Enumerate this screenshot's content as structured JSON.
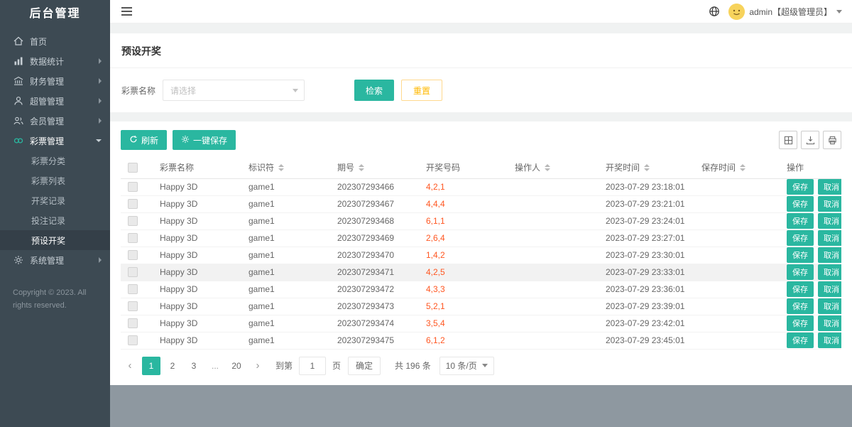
{
  "colors": {
    "accent_teal": "#2ab7a0",
    "warning_orange": "#ffb800",
    "number_red": "#ff5722",
    "sidebar_bg": "#3d4a53"
  },
  "sidebar": {
    "title": "后台管理",
    "items": [
      {
        "label": "首页",
        "icon": "home-icon",
        "arrow": "none"
      },
      {
        "label": "数据统计",
        "icon": "chart-icon",
        "arrow": "right"
      },
      {
        "label": "财务管理",
        "icon": "finance-icon",
        "arrow": "right"
      },
      {
        "label": "超管管理",
        "icon": "admin-user-icon",
        "arrow": "right"
      },
      {
        "label": "会员管理",
        "icon": "members-icon",
        "arrow": "right"
      },
      {
        "label": "彩票管理",
        "icon": "lottery-icon",
        "arrow": "down",
        "children": [
          "彩票分类",
          "彩票列表",
          "开奖记录",
          "投注记录",
          "预设开奖"
        ],
        "active_child": "预设开奖"
      },
      {
        "label": "系统管理",
        "icon": "gear-icon",
        "arrow": "right"
      }
    ],
    "copyright": "Copyright © 2023. All rights reserved."
  },
  "topbar": {
    "username": "admin【超级管理员】"
  },
  "page": {
    "title": "预设开奖",
    "search": {
      "label": "彩票名称",
      "select_placeholder": "请选择",
      "search_button": "检索",
      "reset_button": "重置"
    },
    "toolbar": {
      "refresh_button": "刷新",
      "save_all_button": "一键保存"
    },
    "table": {
      "action_save": "保存",
      "action_cancel": "取消",
      "headers": [
        {
          "label": "彩票名称",
          "sortable": false
        },
        {
          "label": "标识符",
          "sortable": true
        },
        {
          "label": "期号",
          "sortable": true
        },
        {
          "label": "开奖号码",
          "sortable": false
        },
        {
          "label": "操作人",
          "sortable": true
        },
        {
          "label": "开奖时间",
          "sortable": true
        },
        {
          "label": "保存时间",
          "sortable": true
        },
        {
          "label": "操作",
          "sortable": false
        }
      ],
      "rows": [
        {
          "name": "Happy 3D",
          "code": "game1",
          "issue": "202307293466",
          "numbers": "4,2,1",
          "operator": "",
          "draw_time": "2023-07-29 23:18:01",
          "save_time": ""
        },
        {
          "name": "Happy 3D",
          "code": "game1",
          "issue": "202307293467",
          "numbers": "4,4,4",
          "operator": "",
          "draw_time": "2023-07-29 23:21:01",
          "save_time": ""
        },
        {
          "name": "Happy 3D",
          "code": "game1",
          "issue": "202307293468",
          "numbers": "6,1,1",
          "operator": "",
          "draw_time": "2023-07-29 23:24:01",
          "save_time": ""
        },
        {
          "name": "Happy 3D",
          "code": "game1",
          "issue": "202307293469",
          "numbers": "2,6,4",
          "operator": "",
          "draw_time": "2023-07-29 23:27:01",
          "save_time": ""
        },
        {
          "name": "Happy 3D",
          "code": "game1",
          "issue": "202307293470",
          "numbers": "1,4,2",
          "operator": "",
          "draw_time": "2023-07-29 23:30:01",
          "save_time": ""
        },
        {
          "name": "Happy 3D",
          "code": "game1",
          "issue": "202307293471",
          "numbers": "4,2,5",
          "operator": "",
          "draw_time": "2023-07-29 23:33:01",
          "save_time": "",
          "highlight": true
        },
        {
          "name": "Happy 3D",
          "code": "game1",
          "issue": "202307293472",
          "numbers": "4,3,3",
          "operator": "",
          "draw_time": "2023-07-29 23:36:01",
          "save_time": ""
        },
        {
          "name": "Happy 3D",
          "code": "game1",
          "issue": "202307293473",
          "numbers": "5,2,1",
          "operator": "",
          "draw_time": "2023-07-29 23:39:01",
          "save_time": ""
        },
        {
          "name": "Happy 3D",
          "code": "game1",
          "issue": "202307293474",
          "numbers": "3,5,4",
          "operator": "",
          "draw_time": "2023-07-29 23:42:01",
          "save_time": ""
        },
        {
          "name": "Happy 3D",
          "code": "game1",
          "issue": "202307293475",
          "numbers": "6,1,2",
          "operator": "",
          "draw_time": "2023-07-29 23:45:01",
          "save_time": ""
        }
      ]
    },
    "pagination": {
      "prev": "‹",
      "next": "›",
      "pages": [
        {
          "label": "1",
          "active": true
        },
        {
          "label": "2"
        },
        {
          "label": "3"
        },
        {
          "label": "...",
          "ellipsis": true
        },
        {
          "label": "20"
        }
      ],
      "jump_prefix": "到第",
      "jump_value": "1",
      "jump_suffix": "页",
      "confirm_button": "确定",
      "total_text": "共 196 条",
      "per_page": "10 条/页"
    }
  }
}
